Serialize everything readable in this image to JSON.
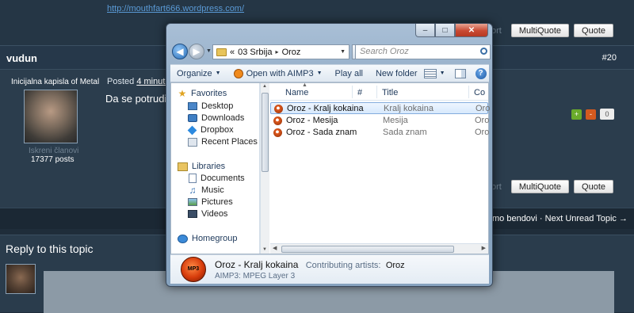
{
  "forum": {
    "top_link": "http://mouthfart666.wordpress.com/",
    "report_label": "Report",
    "multiquote_label": "MultiQuote",
    "quote_label": "Quote",
    "author": "vudun",
    "post_number": "#20",
    "user_rank": "Inicijalna kapisla of Metal",
    "posted_prefix": "Posted",
    "posted_time": "4 minutes",
    "post_text": "Da se potrudiš c",
    "user_group": "Iskreni članovi",
    "user_posts": "17377 posts",
    "rep_up": "+",
    "rep_down": "-",
    "rep_count": "0",
    "topic_nav": "ck to Demo bendovi · Next Unread Topic →",
    "reply_title": "Reply to this topic"
  },
  "explorer": {
    "caption_buttons": [
      "–",
      "□",
      "✕"
    ],
    "address": {
      "prefix": "«",
      "crumbs": [
        "03 Srbija",
        "Oroz"
      ],
      "separator": "▸"
    },
    "search_placeholder": "Search Oroz",
    "toolbar": {
      "organize": "Organize",
      "open_with": "Open with AIMP3",
      "play_all": "Play all",
      "new_folder": "New folder",
      "help": "?"
    },
    "nav": {
      "favorites": "Favorites",
      "desktop": "Desktop",
      "downloads": "Downloads",
      "dropbox": "Dropbox",
      "recent": "Recent Places",
      "libraries": "Libraries",
      "documents": "Documents",
      "music": "Music",
      "pictures": "Pictures",
      "videos": "Videos",
      "homegroup": "Homegroup"
    },
    "columns": {
      "name": "Name",
      "number": "#",
      "title": "Title",
      "contributing": "Co"
    },
    "files": [
      {
        "name": "Oroz - Kralj kokaina",
        "title": "Kralj kokaina",
        "co": "Oro",
        "selected": true
      },
      {
        "name": "Oroz - Mesija",
        "title": "Mesija",
        "co": "Oro",
        "selected": false
      },
      {
        "name": "Oroz - Sada znam",
        "title": "Sada znam",
        "co": "Oro",
        "selected": false
      }
    ],
    "details": {
      "name": "Oroz - Kralj kokaina",
      "artists_label": "Contributing artists:",
      "artists_value": "Oroz",
      "type": "AIMP3: MPEG Layer 3",
      "icon_text": "MP3"
    }
  }
}
